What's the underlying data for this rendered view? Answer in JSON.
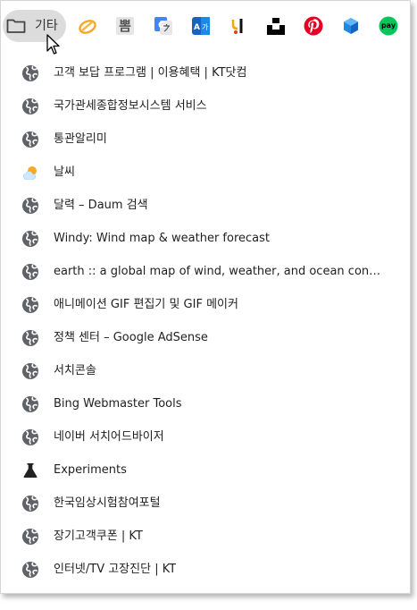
{
  "toolbar": {
    "folder_label": "기타",
    "favicons": [
      {
        "name": "shopping-ring-icon",
        "color": "#f5a623"
      },
      {
        "name": "bbom-icon",
        "text": "뽐",
        "color": "#555555"
      },
      {
        "name": "google-translate-icon",
        "color": "#4285f4"
      },
      {
        "name": "papago-icon",
        "color": "#1e88e5"
      },
      {
        "name": "jobkorea-icon",
        "color": "#000000"
      },
      {
        "name": "unsplash-icon",
        "color": "#000000"
      },
      {
        "name": "pinterest-icon",
        "color": "#e60023"
      },
      {
        "name": "cube-icon",
        "color": "#1e88e5"
      },
      {
        "name": "naver-pay-icon",
        "text": "pay",
        "color": "#03c75a"
      }
    ]
  },
  "menu": {
    "items": [
      {
        "label": "고객 보답 프로그램 | 이용혜택 | KT닷컴",
        "icon": "globe-icon"
      },
      {
        "label": "국가관세종합정보시스템 서비스",
        "icon": "globe-icon"
      },
      {
        "label": "통관알리미",
        "icon": "globe-icon"
      },
      {
        "label": "날씨",
        "icon": "weather-icon"
      },
      {
        "label": "달력 – Daum 검색",
        "icon": "globe-icon"
      },
      {
        "label": "Windy: Wind map & weather forecast",
        "icon": "globe-icon"
      },
      {
        "label": "earth :: a global map of wind, weather, and ocean con…",
        "icon": "globe-icon"
      },
      {
        "label": "애니메이션 GIF 편집기 및 GIF 메이커",
        "icon": "globe-icon"
      },
      {
        "label": "정책 센터 – Google AdSense",
        "icon": "globe-icon"
      },
      {
        "label": "서치콘솔",
        "icon": "globe-icon"
      },
      {
        "label": "Bing Webmaster Tools",
        "icon": "globe-icon"
      },
      {
        "label": "네이버 서치어드바이저",
        "icon": "globe-icon"
      },
      {
        "label": "Experiments",
        "icon": "flask-icon"
      },
      {
        "label": "한국임상시험참여포털",
        "icon": "globe-icon"
      },
      {
        "label": "장기고객쿠폰 | KT",
        "icon": "globe-icon"
      },
      {
        "label": "인터넷/TV 고장진단 | KT",
        "icon": "globe-icon"
      }
    ]
  }
}
